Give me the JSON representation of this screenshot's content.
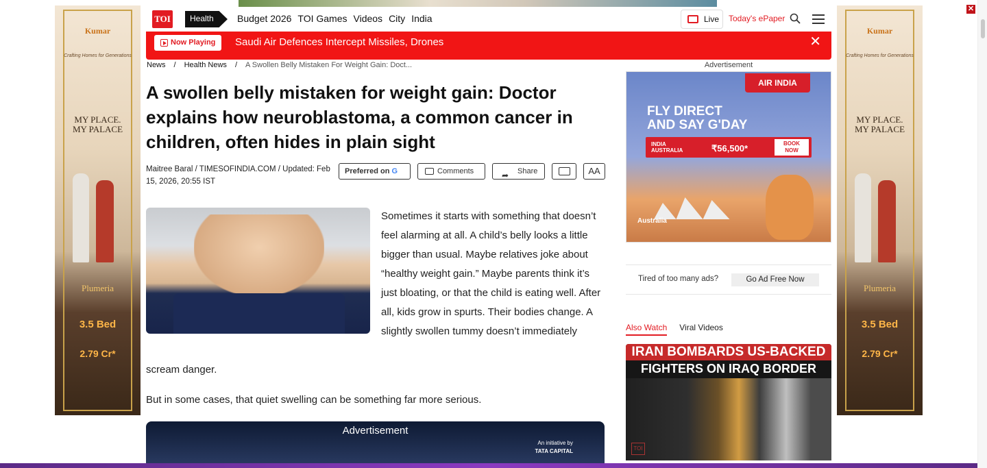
{
  "header": {
    "logo": "TOI",
    "section_tab": "Health",
    "nav_links": [
      "Budget 2026",
      "TOI Games",
      "Videos",
      "City",
      "India"
    ],
    "live_label": "Live",
    "epaper_label": "Today's ePaper"
  },
  "now_playing": {
    "badge": "Now Playing",
    "title": "Saudi Air Defences Intercept Missiles, Drones"
  },
  "breadcrumb": {
    "items": [
      "News",
      "Health News",
      "A Swollen Belly Mistaken For Weight Gain: Doct..."
    ],
    "separator": "/"
  },
  "article": {
    "headline": "A swollen belly mistaken for weight gain: Doctor explains how neuroblastoma, a common cancer in children, often hides in plain sight",
    "byline": "Maitree Baral / TIMESOFINDIA.COM / Updated: Feb 15, 2026, 20:55 IST",
    "actions": {
      "preferred_label": "Preferred on",
      "preferred_g": "G",
      "comments_label": "Comments",
      "share_label": "Share",
      "font_size_label": "AA"
    },
    "para1_wrap": "Sometimes it starts with something that doesn’t feel alarming at all. A child’s belly looks a little bigger than usual. Maybe relatives joke about “healthy weight gain.” Maybe parents think it’s just bloating, or that the child is eating well. After all, kids grow in spurts. Their bodies change. A slightly swollen tummy doesn’t immediately",
    "para1_end": "scream danger.",
    "para2": "But in some cases, that quiet swelling can be something far more serious.",
    "inline_ad_label": "Advertisement",
    "inline_ad_initiative": "An initiative by",
    "inline_ad_brand": "TATA CAPITAL"
  },
  "rail": {
    "ad_label": "Advertisement",
    "ad": {
      "brand": "AIR INDIA",
      "headline_1": "FLY DIRECT",
      "headline_2": "AND SAY G'DAY",
      "route_1": "INDIA",
      "route_2": "AUSTRALIA",
      "fare": "₹56,500*",
      "cta_1": "BOOK",
      "cta_2": "NOW",
      "country": "Australia"
    },
    "adfree_question": "Tired of too many ads?",
    "adfree_button": "Go Ad Free Now",
    "tabs": [
      "Also Watch",
      "Viral Videos"
    ],
    "video_title_1": "IRAN BOMBARDS US-BACKED",
    "video_title_2": "FIGHTERS ON IRAQ BORDER",
    "video_logo": "TOI"
  },
  "side_ads": {
    "brand": "Kumar",
    "brand_sub": "Crafting Homes for Generations",
    "headline_1": "MY PLACE.",
    "headline_2": "MY PALACE",
    "project": "Plumeria",
    "config": "3.5 Bed",
    "price": "2.79 Cr*"
  },
  "colors": {
    "brand_red": "#e21b22",
    "now_playing_bg": "#f11515"
  },
  "icons": [
    "play-icon",
    "close-icon",
    "tv-icon",
    "search-icon",
    "menu-icon",
    "comment-icon",
    "share-icon",
    "print-icon"
  ]
}
